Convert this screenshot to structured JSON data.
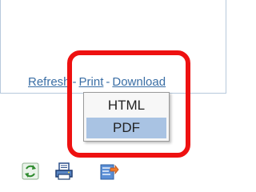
{
  "links": {
    "refresh": "Refresh",
    "separator": "-",
    "print": "Print",
    "download": "Download"
  },
  "print_menu": {
    "options": [
      "HTML",
      "PDF"
    ],
    "selected": "PDF"
  },
  "toolbar": {
    "icons": [
      "refresh-icon",
      "print-icon",
      "download-icon"
    ]
  },
  "colors": {
    "link": "#3a6ea5",
    "highlight": "#ee1111",
    "selected_option": "#a9c3e3"
  }
}
